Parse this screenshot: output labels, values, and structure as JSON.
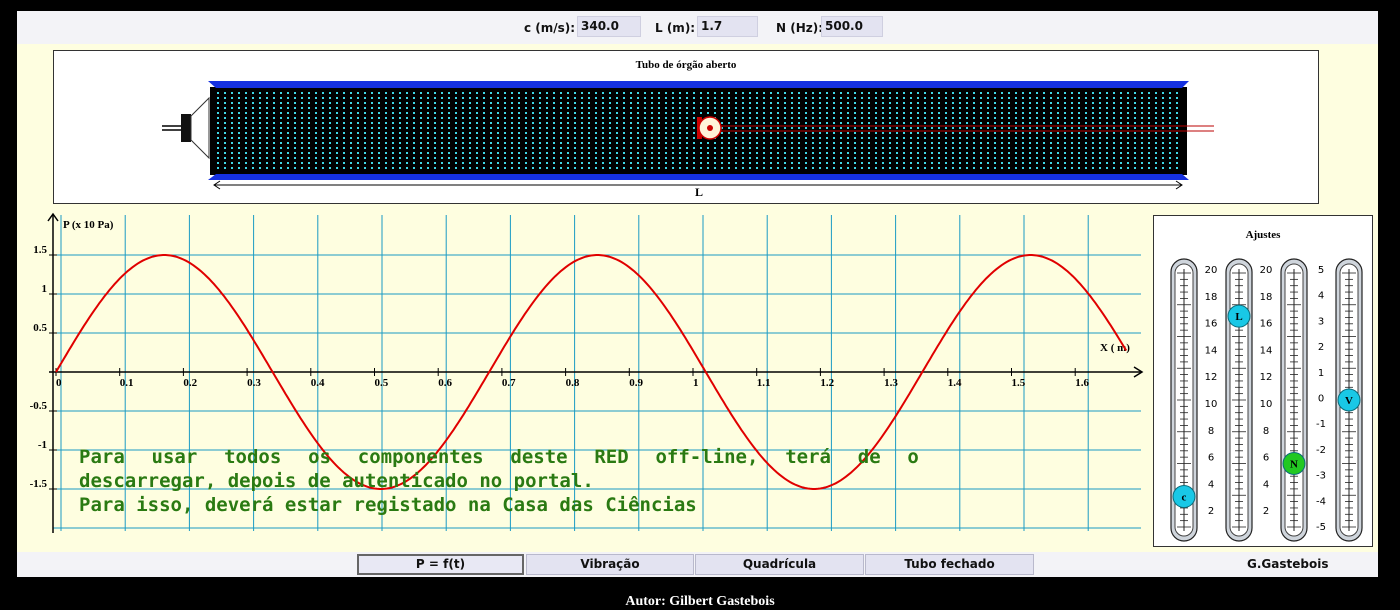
{
  "params": [
    {
      "label": "c (m/s):",
      "value": "340.0"
    },
    {
      "label": "L (m):",
      "value": "1.7"
    },
    {
      "label": "N (Hz):",
      "value": "500.0"
    }
  ],
  "tube": {
    "title": "Tubo de órgão aberto",
    "length_label": "L"
  },
  "graph": {
    "ylabel": "P (x 10 Pa)",
    "xlabel": "X ( m)",
    "yticks": [
      "1.5",
      "1",
      "0.5",
      "-0.5",
      "-1",
      "-1.5"
    ],
    "xticks": [
      "0",
      "0.1",
      "0.2",
      "0.3",
      "0.4",
      "0.5",
      "0.6",
      "0.7",
      "0.8",
      "0.9",
      "1",
      "1.1",
      "1.2",
      "1.3",
      "1.4",
      "1.5",
      "1.6"
    ],
    "curve_color": "#e00000",
    "grid_color": "#1a9bc4"
  },
  "chart_data": {
    "type": "line",
    "title": "",
    "xlabel": "X ( m)",
    "ylabel": "P (x 10 Pa)",
    "xlim": [
      0,
      1.68
    ],
    "ylim": [
      -1.5,
      1.5
    ],
    "grid": true,
    "series": [
      {
        "function": "1.5*sin(2*pi*x/0.68)",
        "amplitude": 1.5,
        "wavelength": 0.68
      }
    ]
  },
  "adjust": {
    "title": "Ajustes",
    "scale_a": [
      "20",
      "18",
      "16",
      "14",
      "12",
      "10",
      "8",
      "6",
      "4",
      "2"
    ],
    "scale_b": [
      "20",
      "18",
      "16",
      "14",
      "12",
      "10",
      "8",
      "6",
      "4",
      "2"
    ],
    "scale_c": [
      "5",
      "4",
      "3",
      "2",
      "1",
      "0",
      "-1",
      "-2",
      "-3",
      "-4",
      "-5"
    ],
    "sliders": [
      {
        "label": "c",
        "color": "#19c8e6",
        "level": 0.12
      },
      {
        "label": "L",
        "color": "#19c8e6",
        "level": 0.83
      },
      {
        "label": "N",
        "color": "#22c822",
        "level": 0.25
      },
      {
        "label": "V",
        "color": "#19c8e6",
        "level": 0.5
      }
    ]
  },
  "buttons": {
    "pt": "P = f(t)",
    "vib": "Vibração",
    "grid": "Quadrícula",
    "closed": "Tubo fechado"
  },
  "credit": "G.Gastebois",
  "overlay": {
    "line1": [
      "Para",
      "usar",
      "todos",
      "os",
      "componentes",
      "deste",
      "RED",
      "off-line,",
      "terá",
      "de",
      "o"
    ],
    "line2": "descarregar, depois de autenticado no portal.",
    "line3": "Para isso, deverá estar registado na Casa das Ciências"
  },
  "author": "Autor: Gilbert Gastebois"
}
